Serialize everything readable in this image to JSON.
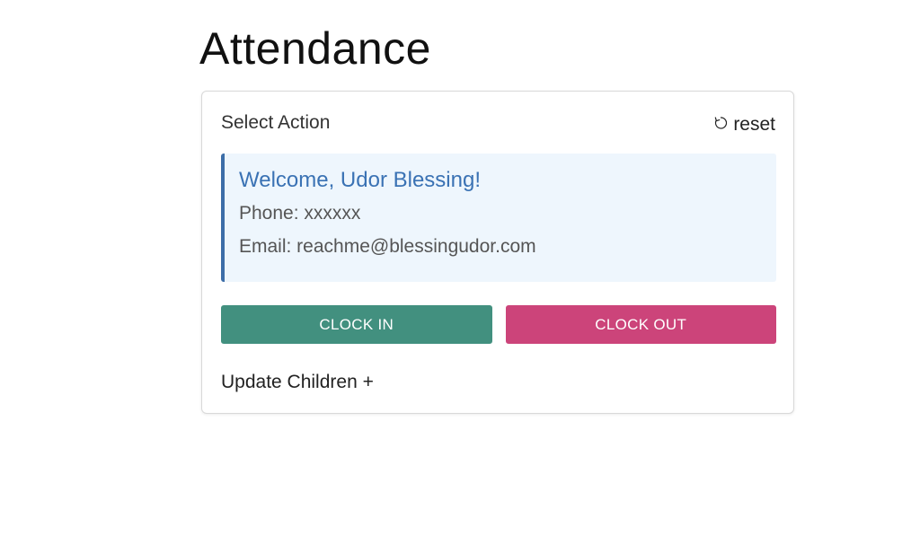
{
  "page": {
    "title": "Attendance"
  },
  "card": {
    "header": {
      "select_action_label": "Select Action",
      "reset_label": "reset",
      "reset_icon": "reset-icon"
    },
    "info": {
      "welcome": "Welcome, Udor Blessing!",
      "phone": "Phone: xxxxxx",
      "email": "Email: reachme@blessingudor.com"
    },
    "buttons": {
      "clock_in": "CLOCK IN",
      "clock_out": "CLOCK OUT"
    },
    "update_children_label": "Update Children +"
  },
  "colors": {
    "info_bg": "#eef6fd",
    "info_border": "#3d6ea8",
    "welcome_text": "#3a72b4",
    "clock_in": "#42907f",
    "clock_out": "#cc447a"
  }
}
